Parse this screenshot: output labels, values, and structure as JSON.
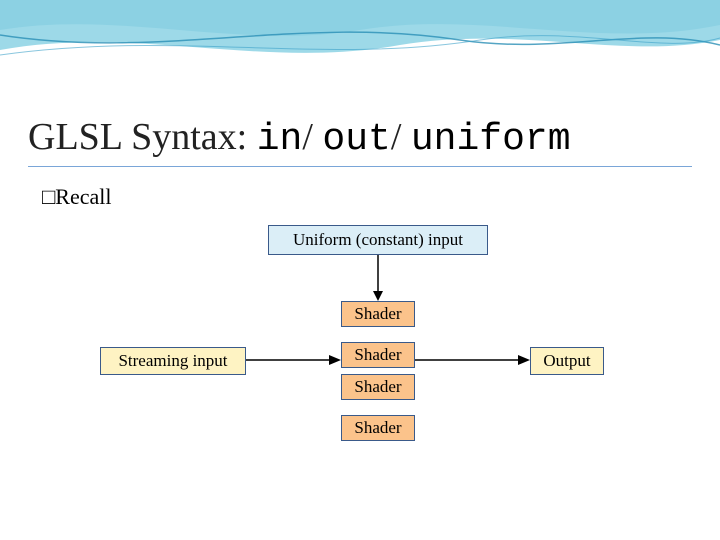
{
  "title": {
    "prefix": "GLSL Syntax: ",
    "kw1": "in",
    "sep": "/ ",
    "kw2": "out",
    "kw3": "uniform"
  },
  "recall": {
    "bullet": "□",
    "text": "Recall"
  },
  "boxes": {
    "uniform": "Uniform (constant) input",
    "shader1": "Shader",
    "shader2": "Shader",
    "shader3": "Shader",
    "shader4": "Shader",
    "streaming": "Streaming input",
    "output": "Output"
  }
}
